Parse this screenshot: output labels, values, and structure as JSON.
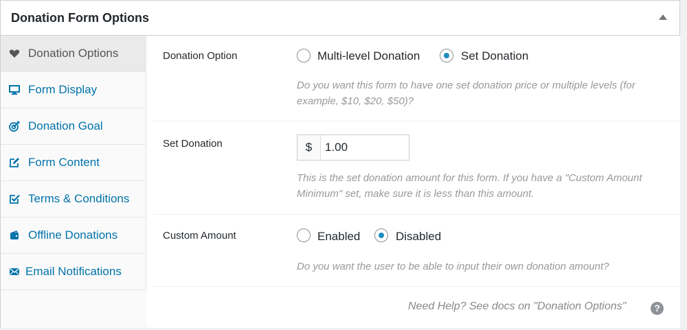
{
  "metabox": {
    "title": "Donation Form Options"
  },
  "sidebar": {
    "items": [
      {
        "label": "Donation Options",
        "icon": "heart-icon",
        "active": true
      },
      {
        "label": "Form Display",
        "icon": "desktop-icon"
      },
      {
        "label": "Donation Goal",
        "icon": "target-icon"
      },
      {
        "label": "Form Content",
        "icon": "edit-icon"
      },
      {
        "label": "Terms & Conditions",
        "icon": "checkbox-icon"
      },
      {
        "label": "Offline Donations",
        "icon": "wallet-icon"
      },
      {
        "label": "Email Notifications",
        "icon": "envelope-icon"
      }
    ]
  },
  "fields": {
    "donation_option": {
      "label": "Donation Option",
      "options": [
        "Multi-level Donation",
        "Set Donation"
      ],
      "selected": "Set Donation",
      "description": "Do you want this form to have one set donation price or multiple levels (for example, $10, $20, $50)?"
    },
    "set_donation": {
      "label": "Set Donation",
      "currency_symbol": "$",
      "value": "1.00",
      "description": "This is the set donation amount for this form. If you have a \"Custom Amount Minimum\" set, make sure it is less than this amount."
    },
    "custom_amount": {
      "label": "Custom Amount",
      "options": [
        "Enabled",
        "Disabled"
      ],
      "selected": "Disabled",
      "description": "Do you want the user to be able to input their own donation amount?"
    }
  },
  "help": {
    "text": "Need Help? See docs on \"Donation Options\"",
    "icon_glyph": "?"
  },
  "colors": {
    "link": "#0073aa",
    "radio_checked": "#1e8cbe"
  }
}
